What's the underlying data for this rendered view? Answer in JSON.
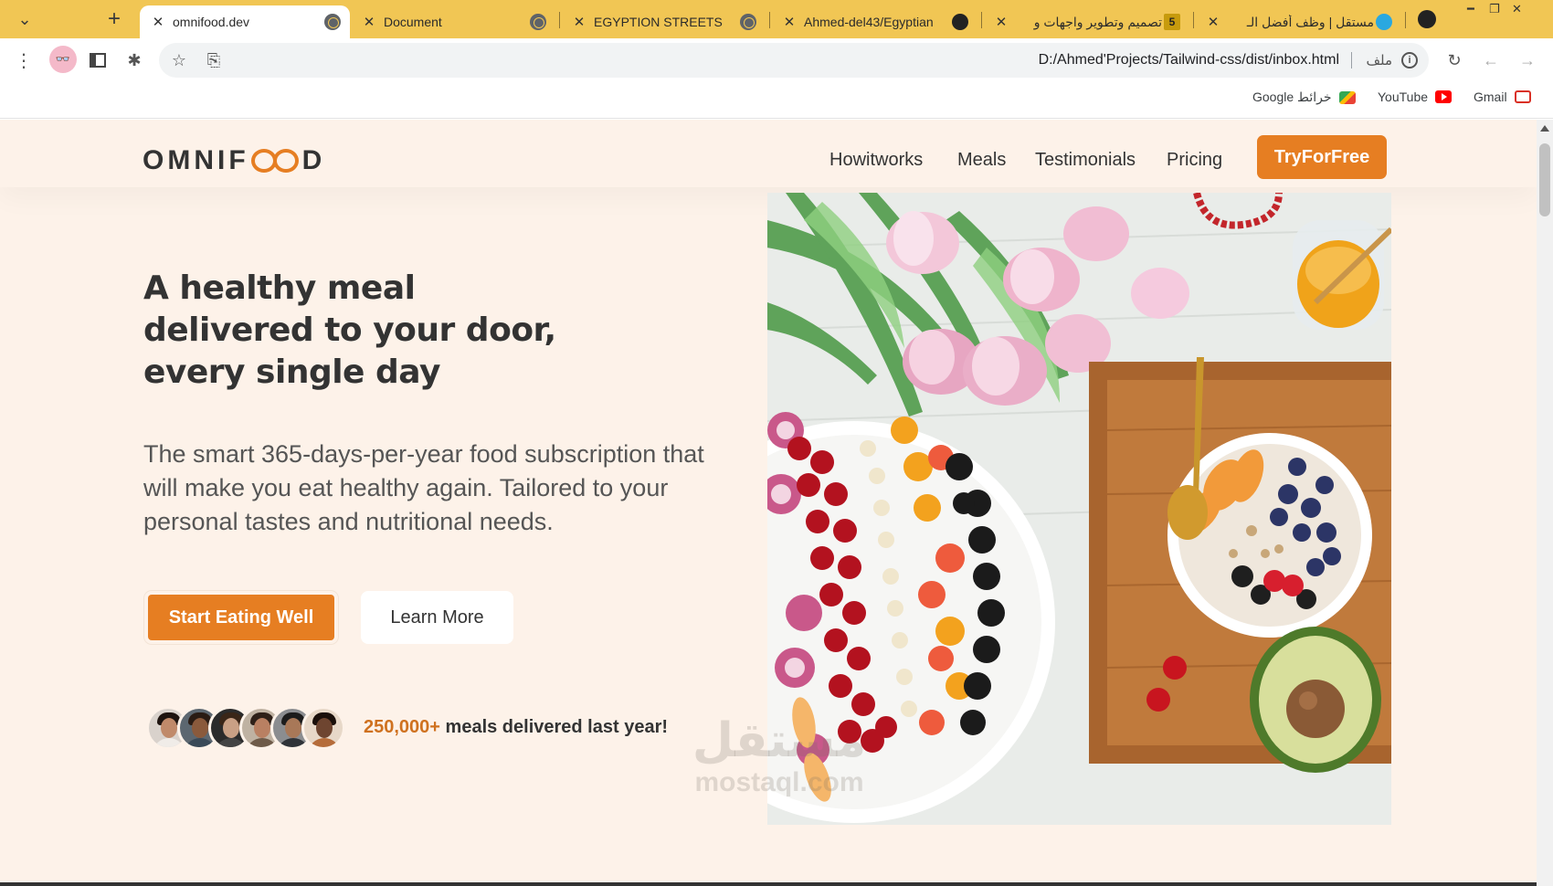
{
  "tabs": [
    {
      "title": "omnifood.dev",
      "active": true
    },
    {
      "title": "Document"
    },
    {
      "title": "EGYPTION STREETS"
    },
    {
      "title": "Ahmed-del43/Egyptian"
    },
    {
      "title": "تصميم وتطوير واجهات و",
      "badge": "5"
    },
    {
      "title": "مستقل | وظف أفضل الـ"
    }
  ],
  "toolbar": {
    "url": "D:/Ahmed'Projects/Tailwind-css/dist/inbox.html",
    "file_label": "ملف"
  },
  "bookmarks": [
    {
      "label": "Gmail",
      "icon": "gmail-icon"
    },
    {
      "label": "YouTube",
      "icon": "youtube-icon"
    },
    {
      "label": "خرائط Google",
      "icon": "maps-icon"
    }
  ],
  "site": {
    "logo_left": "OMNIF",
    "logo_right": "D",
    "nav": [
      "Howitworks",
      "Meals",
      "Testimonials",
      "Pricing"
    ],
    "cta": "TryForFree",
    "hero_title": [
      "A healthy meal",
      "delivered to your door,",
      "every single day"
    ],
    "hero_desc": "The smart 365-days-per-year food subscription that will make you eat healthy again. Tailored to your personal tastes and nutritional needs.",
    "btn_start": "Start Eating Well",
    "btn_learn": "Learn More",
    "delivered_count": "250,000+",
    "delivered_text": " meals delivered last year!"
  },
  "watermark": {
    "ar": "مستقل",
    "en": "mostaql.com"
  },
  "colors": {
    "brand": "#e67e22",
    "page_bg": "#fdf2e9",
    "tabstrip": "#f1c654"
  }
}
